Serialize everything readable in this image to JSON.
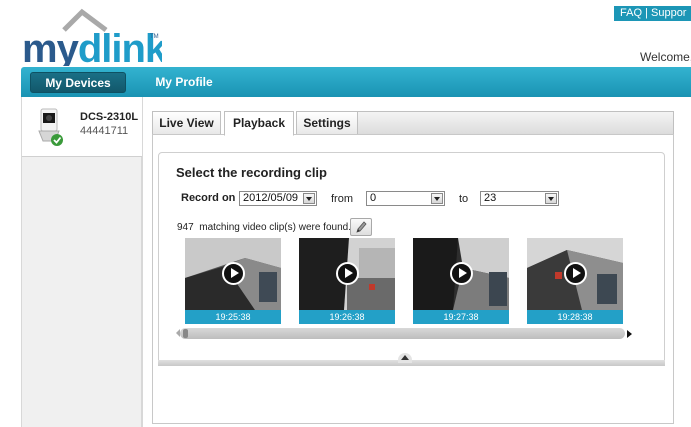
{
  "header": {
    "brand_name": "mydlink",
    "top_links": {
      "faq": "FAQ",
      "separator": "|",
      "support": "Suppor"
    },
    "welcome": "Welcome,"
  },
  "nav": {
    "tabs": [
      {
        "label": "My Devices",
        "active": true
      },
      {
        "label": "My Profile",
        "active": false
      }
    ]
  },
  "device": {
    "name": "DCS-2310L",
    "id": "44441711",
    "status": "online-check-icon"
  },
  "tabs": [
    {
      "label": "Live View",
      "active": false
    },
    {
      "label": "Playback",
      "active": true
    },
    {
      "label": "Settings",
      "active": false
    }
  ],
  "playback": {
    "title": "Select the recording clip",
    "record_on_label": "Record on",
    "date_value": "2012/05/09",
    "from_label": "from",
    "from_value": "0",
    "to_label": "to",
    "to_value": "23",
    "match_count": "947",
    "match_text": "matching video clip(s) were found.",
    "clips": [
      {
        "time": "19:25:38"
      },
      {
        "time": "19:26:38"
      },
      {
        "time": "19:27:38"
      },
      {
        "time": "19:28:38"
      }
    ]
  },
  "colors": {
    "accent": "#23a0c7",
    "nav_bar": "#1a93b3",
    "active_nav": "#12586b",
    "check_green": "#3a9a3a"
  }
}
